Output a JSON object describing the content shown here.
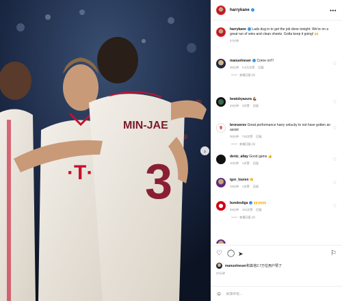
{
  "post": {
    "username": "harrykane",
    "caption": "Lads dug in to get the job done tonight. We're on a great run of wins and clean sheets. Gotta keep it going! 🙌",
    "caption_meta": "37分钟",
    "photo": {
      "jersey_name": "MIN-JAE",
      "jersey_number": "3"
    }
  },
  "comments": [
    {
      "user": "manuelneuer",
      "verified": true,
      "text": "Come on!!!",
      "time": "36分钟",
      "likes": "2.6万次赞",
      "reply": "回复",
      "view_replies": "查看回复 (6)"
    },
    {
      "user": "beatsbyazura",
      "verified": false,
      "text": "💪🏾",
      "time": "33分钟",
      "likes": "3次赞",
      "reply": "回复"
    },
    {
      "user": "bronzerov",
      "verified": false,
      "text": "Great performance harry unlucky to not have gotten an assist",
      "time": "36分钟",
      "likes": "742次赞",
      "reply": "回复",
      "view_replies": "查看回复 (3)"
    },
    {
      "user": "deniz_altay",
      "verified": false,
      "text": "Good game 👍",
      "time": "10分钟",
      "likes": "1次赞",
      "reply": "回复"
    },
    {
      "user": "igor_louren",
      "verified": false,
      "text": "👏",
      "time": "19分钟",
      "likes": "1次赞",
      "reply": "回复"
    },
    {
      "user": "bundesliga",
      "verified": true,
      "text": "🙌🙌🙌",
      "time": "29分钟",
      "likes": "101次赞",
      "reply": "回复",
      "view_replies": "查看回复 (2)"
    }
  ],
  "liked_by": {
    "user": "manuelneuer",
    "text": "和其他2.7万位用户赞了"
  },
  "date": "37分钟",
  "add_comment": {
    "placeholder": "添加评论..."
  },
  "icons": {
    "like": "heart-icon",
    "comment": "comment-icon",
    "share": "share-icon",
    "save": "bookmark-icon",
    "emoji": "emoji-icon",
    "more": "more-icon",
    "next": "chevron-right-icon"
  },
  "colors": {
    "verified": "#3897f0",
    "fcb_red": "#d20515"
  }
}
